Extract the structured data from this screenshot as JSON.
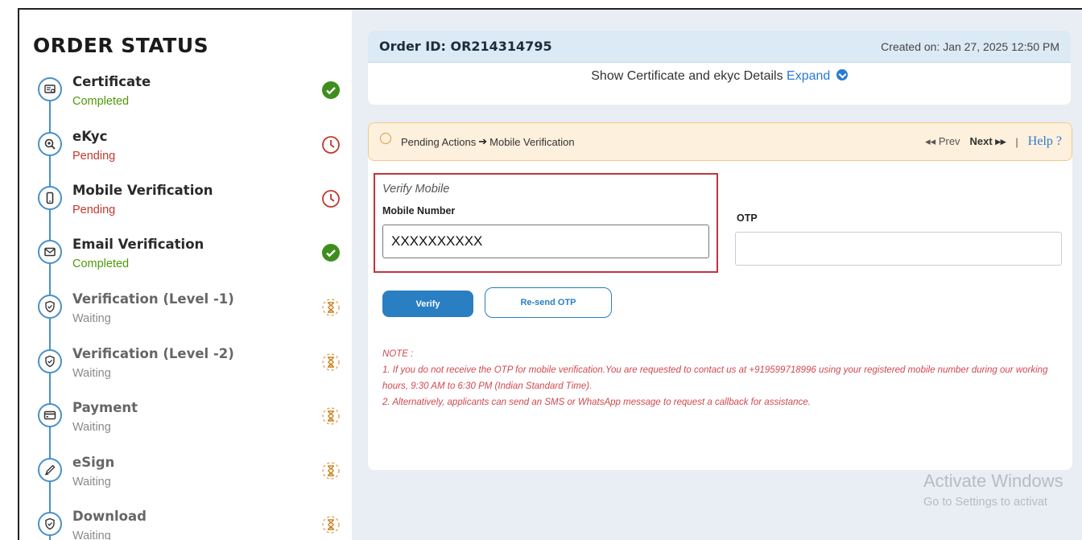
{
  "sidebar": {
    "title": "ORDER STATUS",
    "steps": [
      {
        "name": "Certificate",
        "status": "Completed",
        "state": "completed",
        "icon": "certificate-icon"
      },
      {
        "name": "eKyc",
        "status": "Pending",
        "state": "pending",
        "icon": "search-icon"
      },
      {
        "name": "Mobile Verification",
        "status": "Pending",
        "state": "pending",
        "icon": "mobile-icon"
      },
      {
        "name": "Email Verification",
        "status": "Completed",
        "state": "completed",
        "icon": "mail-icon"
      },
      {
        "name": "Verification (Level -1)",
        "status": "Waiting",
        "state": "waiting",
        "icon": "shield-icon"
      },
      {
        "name": "Verification (Level -2)",
        "status": "Waiting",
        "state": "waiting",
        "icon": "shield-icon"
      },
      {
        "name": "Payment",
        "status": "Waiting",
        "state": "waiting",
        "icon": "card-icon"
      },
      {
        "name": "eSign",
        "status": "Waiting",
        "state": "waiting",
        "icon": "pen-icon"
      },
      {
        "name": "Download",
        "status": "Waiting",
        "state": "waiting",
        "icon": "shield-icon"
      }
    ]
  },
  "order": {
    "id_label": "Order ID: OR214314795",
    "created": "Created on: Jan 27, 2025 12:50 PM",
    "show_text": "Show Certificate and ekyc Details",
    "expand_label": "Expand"
  },
  "pending": {
    "text": "Pending Actions",
    "arrow": "➔",
    "current": "Mobile Verification",
    "prev_label": "Prev",
    "next_label": "Next",
    "separator": "|",
    "help_label": "Help ?"
  },
  "verify": {
    "title": "Verify Mobile",
    "mobile_label": "Mobile Number",
    "mobile_value": "XXXXXXXXXX",
    "otp_label": "OTP",
    "otp_value": "",
    "verify_button": "Verify",
    "resend_button": "Re-send OTP"
  },
  "note": {
    "heading": "NOTE :",
    "line1": "1. If you do not receive the OTP for mobile verification.You are requested to contact us at +919599718996 using your registered mobile number during our working hours, 9:30 AM to 6:30 PM (Indian Standard Time).",
    "line2": "2. Alternatively, applicants can send an SMS or WhatsApp message to request a callback for assistance."
  },
  "watermark": {
    "line1": "Activate Windows",
    "line2": "Go to Settings to activat"
  },
  "colors": {
    "accent": "#2a7fc2",
    "completed": "#4e9a06",
    "pending": "#c0392b",
    "waiting": "#d99a4a",
    "highlight_border": "#c0343b"
  }
}
